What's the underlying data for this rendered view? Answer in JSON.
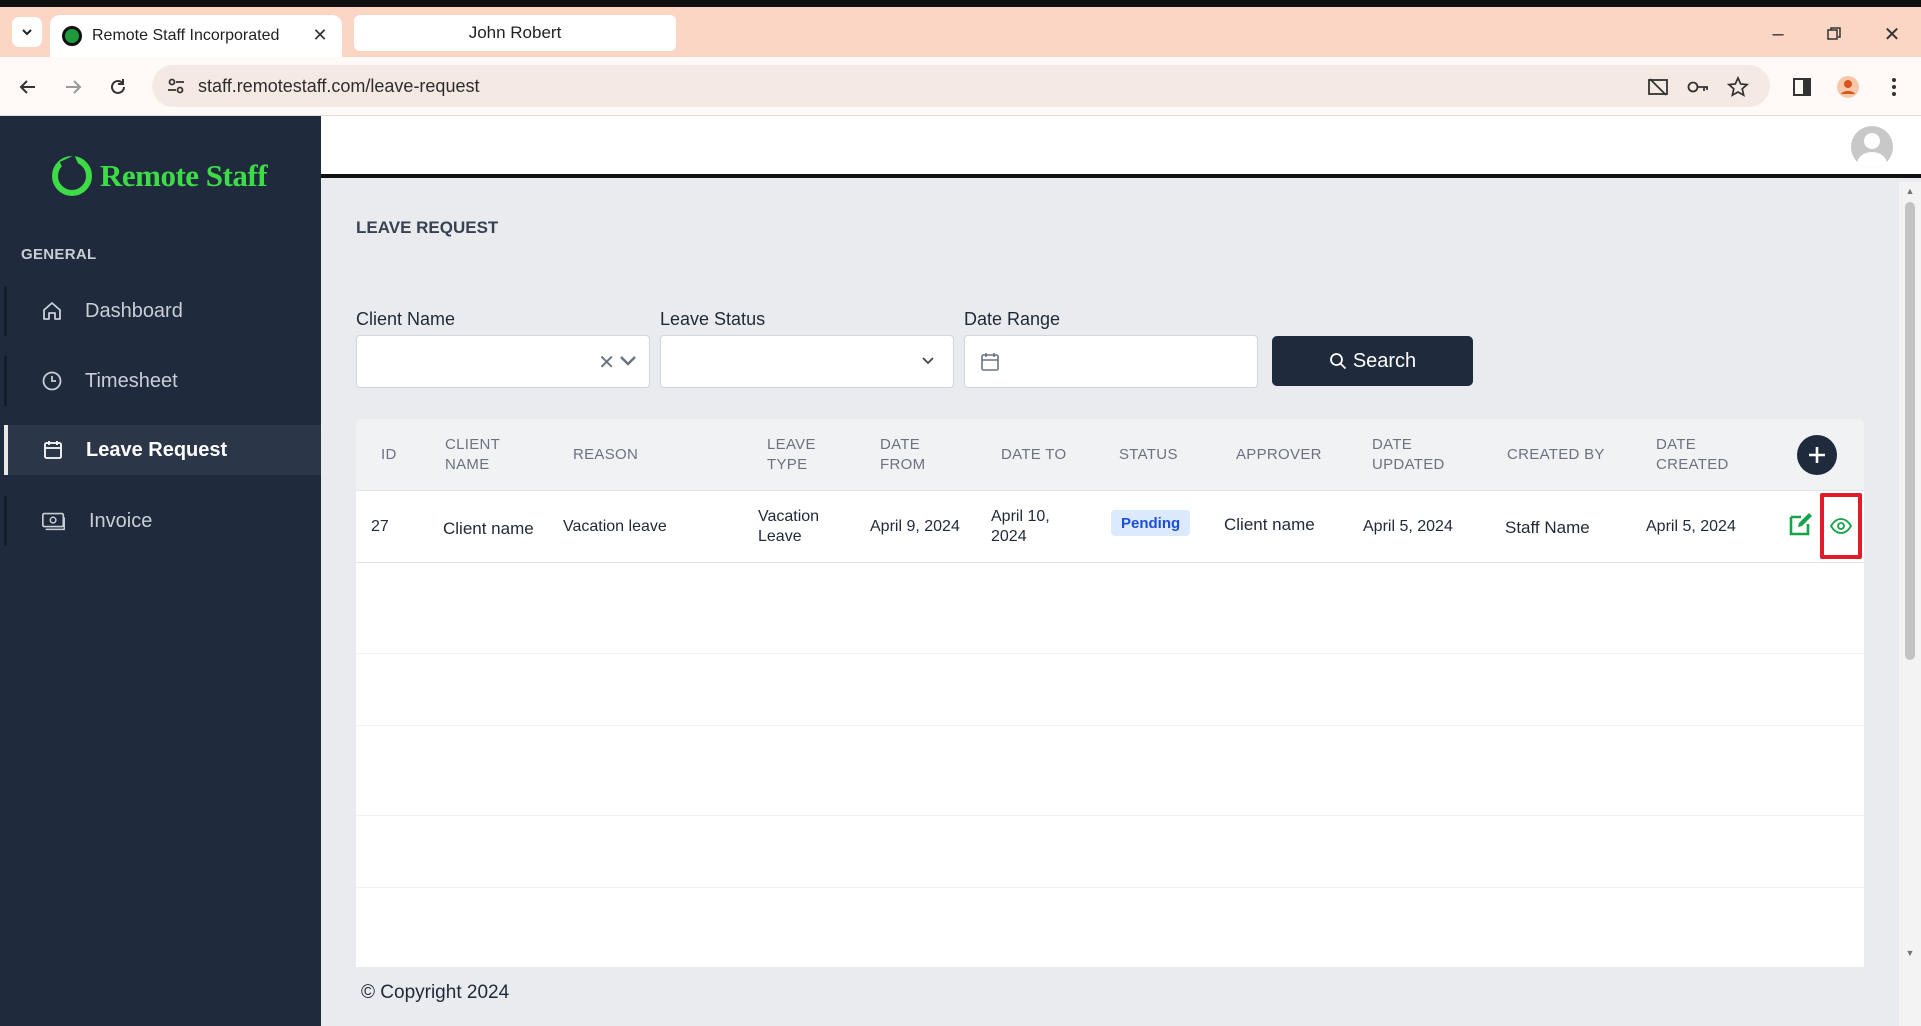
{
  "browser": {
    "tabs": [
      {
        "title": "Remote Staff Incorporated"
      },
      {
        "title": "John Robert"
      }
    ],
    "url": "staff.remotestaff.com/leave-request"
  },
  "sidebar": {
    "logo_text": "Remote Staff",
    "section": "GENERAL",
    "items": [
      {
        "label": "Dashboard",
        "icon": "home-icon"
      },
      {
        "label": "Timesheet",
        "icon": "clock-icon"
      },
      {
        "label": "Leave Request",
        "icon": "calendar-icon",
        "active": true
      },
      {
        "label": "Invoice",
        "icon": "invoice-icon"
      }
    ]
  },
  "page": {
    "title": "LEAVE REQUEST"
  },
  "filters": {
    "client_name_label": "Client Name",
    "leave_status_label": "Leave Status",
    "date_range_label": "Date Range",
    "search_label": "Search"
  },
  "table": {
    "headers": {
      "id": "ID",
      "client_name": [
        "CLIENT",
        "NAME"
      ],
      "reason": "REASON",
      "leave_type": [
        "LEAVE",
        "TYPE"
      ],
      "date_from": [
        "DATE",
        "FROM"
      ],
      "date_to": "DATE TO",
      "status": "STATUS",
      "approver": "APPROVER",
      "date_updated": [
        "DATE",
        "UPDATED"
      ],
      "created_by": "CREATED BY",
      "date_created": [
        "DATE",
        "CREATED"
      ]
    },
    "rows": [
      {
        "id": "27",
        "client_name": "Client name",
        "reason": "Vacation leave",
        "leave_type": [
          "Vacation",
          "Leave"
        ],
        "date_from": "April 9, 2024",
        "date_to": [
          "April 10,",
          "2024"
        ],
        "status": "Pending",
        "approver": "Client name",
        "date_updated": "April 5, 2024",
        "created_by": "Staff Name",
        "date_created": "April 5, 2024"
      }
    ]
  },
  "footer": {
    "copyright": "© Copyright 2024"
  },
  "colors": {
    "sidebar_bg": "#1f2a3d",
    "brand_green": "#3ddc47",
    "status_badge_bg": "#dbeafe",
    "highlight_red": "#e21b2a"
  }
}
